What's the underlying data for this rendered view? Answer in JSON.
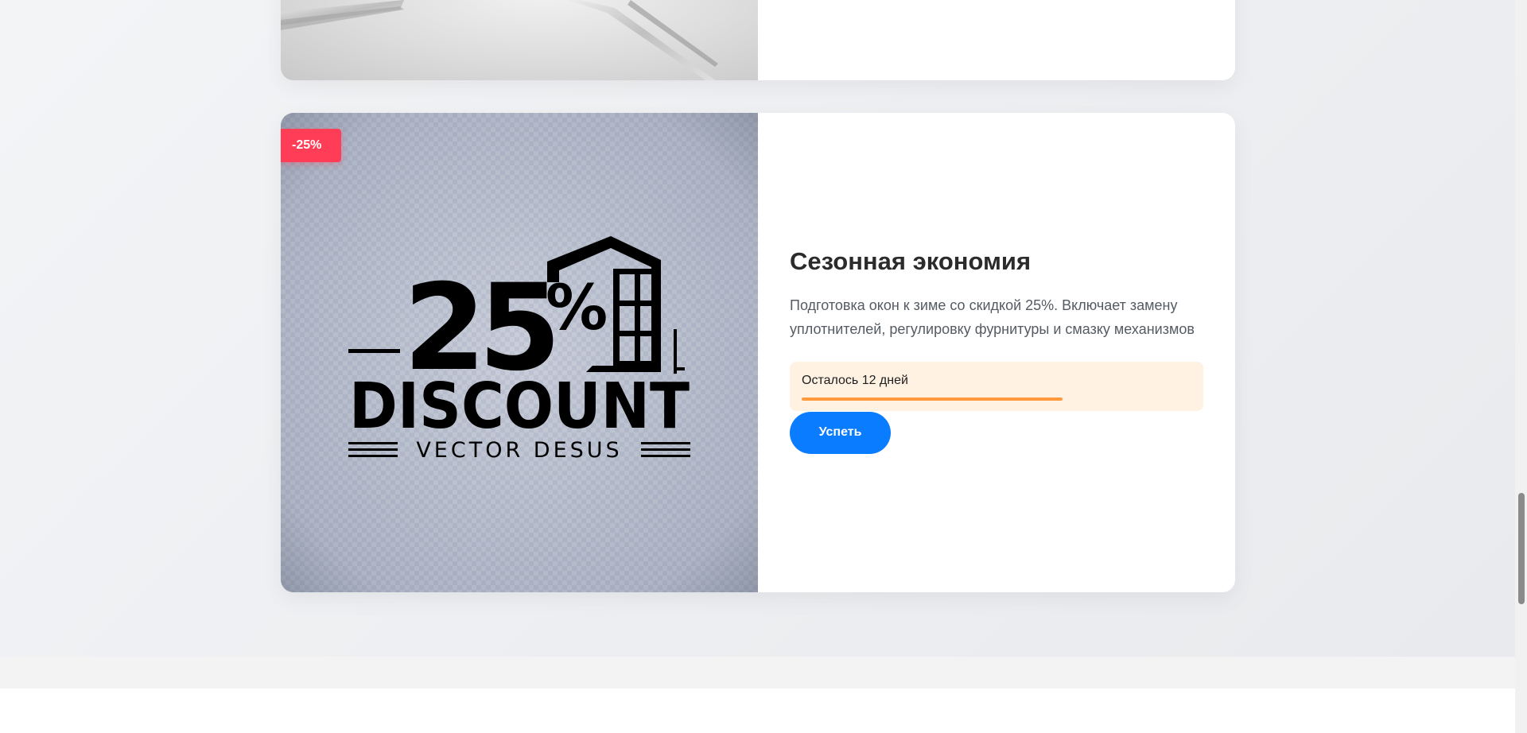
{
  "offers": [
    {
      "id": "previous-offer",
      "image": "silver-window-profile-photo"
    },
    {
      "id": "seasonal-offer",
      "badge": "-25%",
      "image": "25-discount-logo",
      "logo": {
        "number": "25",
        "percent": "%",
        "word": "DISCOUNT",
        "tagline": "VECTOR DESUS"
      },
      "title": "Сезонная экономия",
      "description": "Подготовка окон к зиме со скидкой 25%. Включает замену уплотнителей, регулировку фурнитуры и смазку механизмов",
      "timer": {
        "text": "Осталось 12 дней",
        "progress_fraction": 0.67,
        "color": "#ff9a3c"
      },
      "button": "Успеть"
    }
  ],
  "colors": {
    "accent": "#0a7cff",
    "badge": "#ff3d57",
    "timer_bg": "#fff2e3",
    "title": "#2b2b2b"
  }
}
